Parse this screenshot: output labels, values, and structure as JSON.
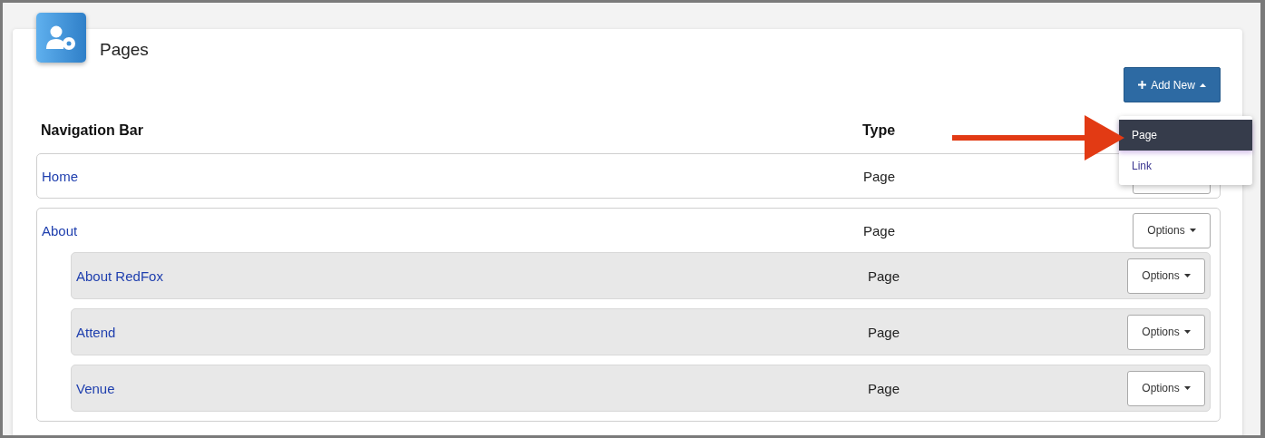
{
  "header": {
    "title": "Pages"
  },
  "add_button": {
    "label": "Add New",
    "expanded": true
  },
  "dropdown": [
    {
      "label": "Page",
      "selected": true
    },
    {
      "label": "Link",
      "selected": false
    }
  ],
  "columns": [
    "Navigation Bar",
    "Type"
  ],
  "items": [
    {
      "name": "Home",
      "type": "Page"
    },
    {
      "name": "About",
      "type": "Page",
      "options": "Options",
      "children": [
        {
          "name": "About RedFox",
          "type": "Page",
          "options": "Options"
        },
        {
          "name": "Attend",
          "type": "Page",
          "options": "Options"
        },
        {
          "name": "Venue",
          "type": "Page",
          "options": "Options"
        }
      ]
    }
  ]
}
